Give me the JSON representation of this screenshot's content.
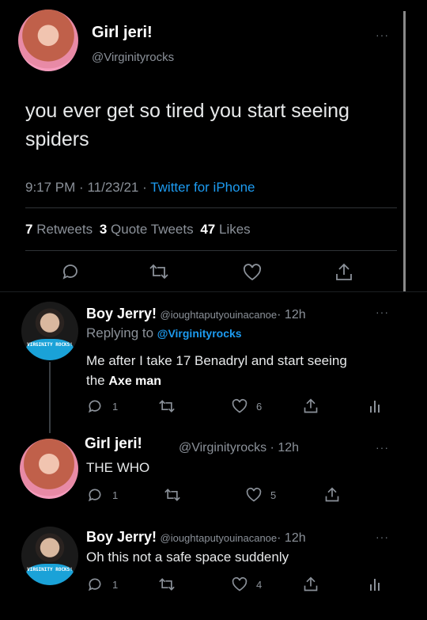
{
  "main_tweet": {
    "name": "Girl jeri!",
    "handle": "@Virginityrocks",
    "text_line1": "you ever get so tired you start seeing",
    "text_line2": "spiders",
    "time": "9:17 PM",
    "date": "11/23/21",
    "separator": "·",
    "source": "Twitter for iPhone",
    "retweets_count": "7",
    "retweets_label": "Retweets",
    "quotes_count": "3",
    "quotes_label": "Quote Tweets",
    "likes_count": "47",
    "likes_label": "Likes"
  },
  "replies": [
    {
      "name": "Boy Jerry!",
      "handle": "@ioughtaputyouinacanoe",
      "time": "· 12h",
      "replying_label": "Replying to",
      "replying_handle": "@Virginityrocks",
      "text_line1": "Me after I take 17 Benadryl and start seeing",
      "text_line2_prefix": "the",
      "text_line2_bold": "Axe man",
      "reply_count": "1",
      "like_count": "6",
      "shirt_text": "VIRGINITY ROCKS!"
    },
    {
      "name": "Girl jeri!",
      "handle": "@Virginityrocks",
      "time": "· 12h",
      "text": "THE WHO",
      "reply_count": "1",
      "like_count": "5"
    },
    {
      "name": "Boy Jerry!",
      "handle": "@ioughtaputyouinacanoe",
      "time": "· 12h",
      "text": "Oh this not a safe space suddenly",
      "reply_count": "1",
      "like_count": "4",
      "shirt_text": "VIRGINITY ROCKS!"
    }
  ],
  "ui": {
    "more_icon": "more-dots-icon",
    "reply_icon": "reply-bubble-icon",
    "retweet_icon": "retweet-icon",
    "like_icon": "heart-icon",
    "share_icon": "share-icon",
    "analytics_icon": "analytics-icon",
    "dots": "···"
  }
}
